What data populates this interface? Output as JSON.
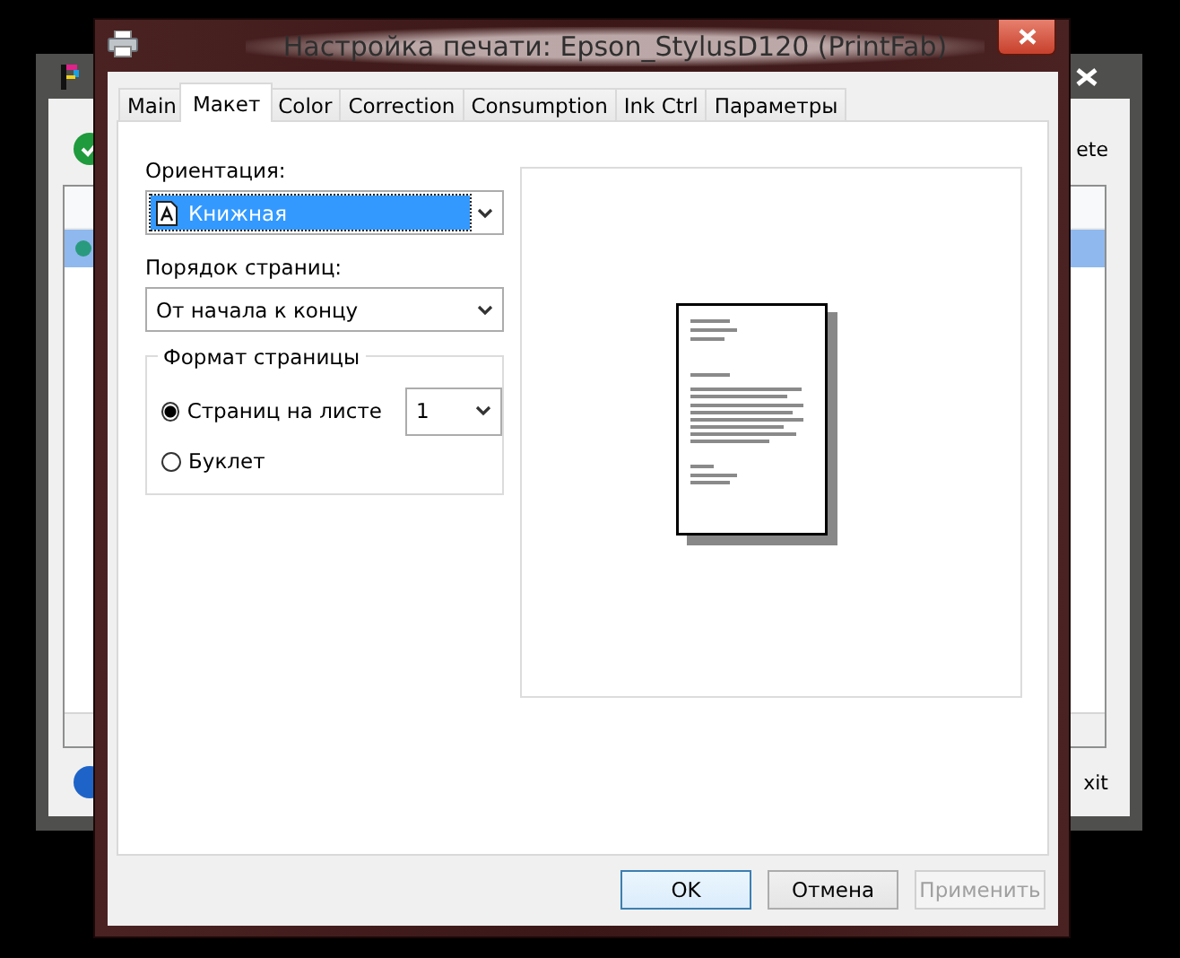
{
  "background_window": {
    "toolbar_text": "ete",
    "list": {
      "rows": [
        {
          "selected": true
        }
      ]
    },
    "footer_text": "xit"
  },
  "dialog": {
    "title": "Настройка печати: Epson_StylusD120 (PrintFab)",
    "tabs": [
      {
        "label": "Main",
        "selected": false
      },
      {
        "label": "Макет",
        "selected": true
      },
      {
        "label": "Color",
        "selected": false
      },
      {
        "label": "Correction",
        "selected": false
      },
      {
        "label": "Consumption",
        "selected": false
      },
      {
        "label": "Ink Ctrl",
        "selected": false
      },
      {
        "label": "Параметры",
        "selected": false
      }
    ],
    "orientation": {
      "label": "Ориентация:",
      "value": "Книжная",
      "focused": true
    },
    "page_order": {
      "label": "Порядок страниц:",
      "value": "От начала к концу",
      "focused": false
    },
    "page_format": {
      "legend": "Формат страницы",
      "options": [
        {
          "label": "Страниц на листе",
          "selected": true,
          "kind": "count"
        },
        {
          "label": "Буклет",
          "selected": false,
          "kind": "plain"
        }
      ],
      "pages_per_sheet": "1"
    },
    "buttons": [
      {
        "label": "OK",
        "default": true,
        "disabled": false
      },
      {
        "label": "Отмена",
        "default": false,
        "disabled": false
      },
      {
        "label": "Применить",
        "default": false,
        "disabled": true
      }
    ]
  }
}
